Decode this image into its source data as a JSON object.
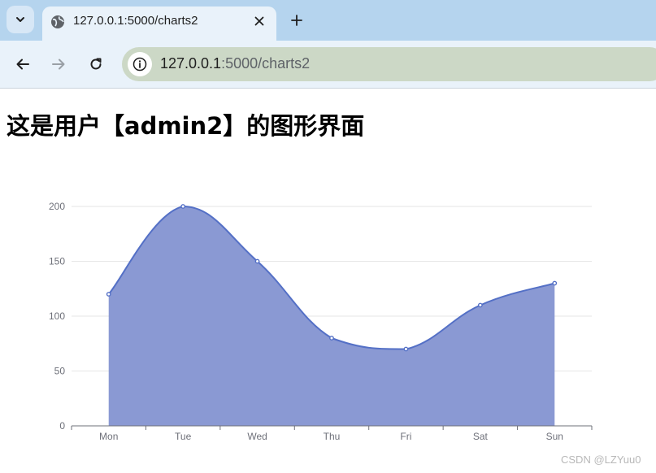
{
  "browser": {
    "tab_title": "127.0.0.1:5000/charts2",
    "url_host": "127.0.0.1",
    "url_rest": ":5000/charts2",
    "icons": {
      "tab_list": "chevron-down-icon",
      "favicon": "globe-icon",
      "close": "close-icon",
      "new_tab": "plus-icon",
      "back": "back-arrow-icon",
      "forward": "forward-arrow-icon",
      "reload": "reload-icon",
      "site_info": "info-icon"
    },
    "colors": {
      "tabstrip": "#b5d4ee",
      "toolbar": "#e9f2fa",
      "omnibox": "#ccd8c6"
    }
  },
  "page": {
    "heading": "这是用户【admin2】的图形界面",
    "watermark": "CSDN @LZYuu0"
  },
  "chart_data": {
    "type": "area",
    "smooth": true,
    "categories": [
      "Mon",
      "Tue",
      "Wed",
      "Thu",
      "Fri",
      "Sat",
      "Sun"
    ],
    "series": [
      {
        "values": [
          120,
          200,
          150,
          80,
          70,
          110,
          130
        ]
      }
    ],
    "ylim": [
      0,
      200
    ],
    "yticks": [
      0,
      50,
      100,
      150,
      200
    ],
    "grid": true,
    "colors": {
      "line": "#5470c6",
      "fill": "#8a99d3",
      "grid": "#e6e6e6",
      "axis": "#6e7079"
    }
  }
}
